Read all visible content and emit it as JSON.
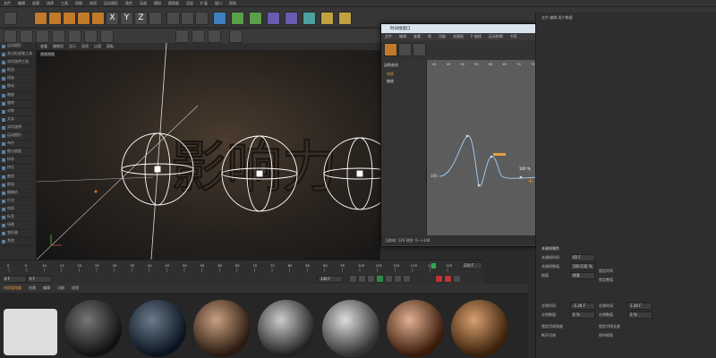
{
  "app": {
    "menu": [
      "文件",
      "编辑",
      "创建",
      "选择",
      "工具",
      "网格",
      "体积",
      "运动图形",
      "角色",
      "动画",
      "模拟",
      "跟踪器",
      "渲染",
      "扩展",
      "窗口",
      "帮助"
    ]
  },
  "toolbar": {
    "axis_buttons": [
      "X",
      "Y",
      "Z"
    ]
  },
  "left_panel": {
    "items": [
      "运动图形",
      "多边形画笔工具",
      "实时选择工具",
      "框选",
      "线选",
      "移动",
      "缩放",
      "旋转",
      "对称",
      "文本",
      "实时选择",
      "运动图形",
      "布尔",
      "细分曲面",
      "样条",
      "挤压",
      "曲线",
      "群组",
      "摄像机",
      "灯光",
      "材质",
      "标签",
      "场景",
      "变形器",
      "其他"
    ]
  },
  "viewport": {
    "header": [
      "查看",
      "摄像机",
      "显示",
      "选项",
      "过滤",
      "面板"
    ],
    "title": "透视视图"
  },
  "graph_window": {
    "title": "时间线窗口",
    "menu": [
      "文件",
      "编辑",
      "查看",
      "帧",
      "功能",
      "关键帧",
      "F-曲线",
      "运动剪辑",
      "书签"
    ],
    "tracks": [
      "材质",
      "缩放"
    ],
    "curve_label": "函数曲线",
    "ruler": [
      "40",
      "45",
      "50",
      "55",
      "60",
      "65",
      "70",
      "75",
      "80",
      "85",
      "90",
      "95",
      "100",
      "105",
      "110",
      "115",
      "120"
    ],
    "key_value_label": "100 %",
    "left_value": "100",
    "status": "当前帧: 120 预览: 0-->140"
  },
  "timeline": {
    "ticks": [
      "0",
      "5",
      "10",
      "15",
      "20",
      "25",
      "30",
      "35",
      "40",
      "45",
      "50",
      "55",
      "60",
      "65",
      "70",
      "75",
      "80",
      "85",
      "90",
      "95",
      "100",
      "105",
      "110",
      "115",
      "120",
      "125"
    ],
    "current_frame": "0 F",
    "start": "0 F",
    "end": "140 F",
    "marker": "120",
    "end_field": "120 F"
  },
  "material_bar": {
    "tabs": [
      "创建",
      "编辑",
      "功能",
      "纹理"
    ],
    "header": "材质管理器"
  },
  "attributes": {
    "header": "文件 编辑 用户数据",
    "title": "关键帧属性",
    "rows": [
      {
        "label": "关键帧时间",
        "value": "65 F"
      },
      {
        "label": "关键帧数值",
        "value": "100.535 %"
      },
      {
        "label": "插值",
        "value": "样条"
      },
      {
        "label": "锁定时间",
        "value": ""
      },
      {
        "label": "锁定数值",
        "value": ""
      }
    ],
    "rows2": [
      {
        "label": "左侧时间",
        "value": "-1.26 F"
      },
      {
        "label": "左侧数值",
        "value": "0 %"
      },
      {
        "label": "右侧时间",
        "value": "1.26 F"
      },
      {
        "label": "右侧数值",
        "value": "0 %"
      }
    ],
    "checks": [
      "锁定切线角度",
      "锁定切线长度",
      "断开切线",
      "保持视角"
    ]
  },
  "colors": {
    "accent": "#5a7fa6",
    "curve": "#9fc4e8",
    "playhead": "#2ea84a"
  }
}
